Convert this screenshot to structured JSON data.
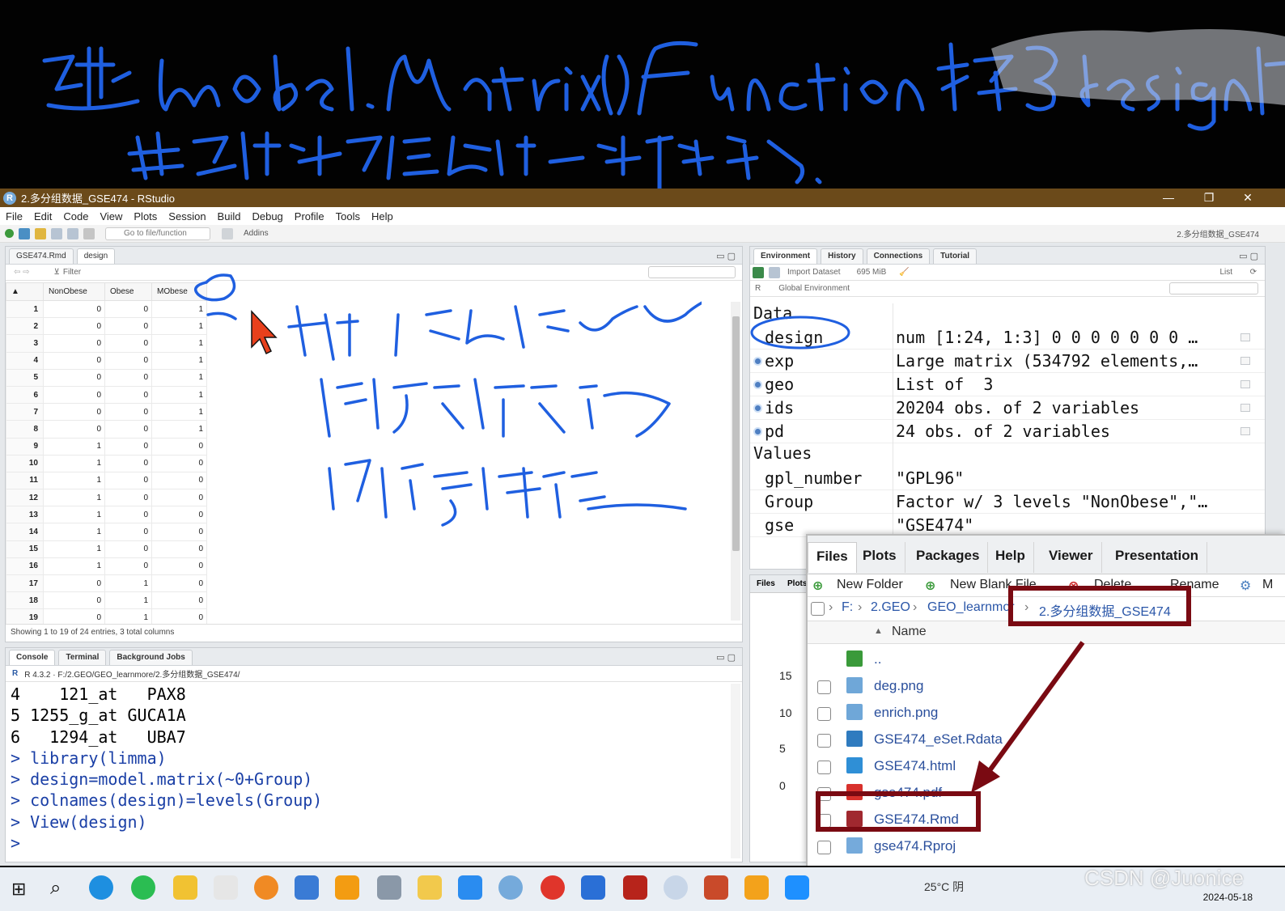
{
  "window": {
    "title": "2.多分组数据_GSE474 - RStudio",
    "controls": [
      "—",
      "❐",
      "✕"
    ]
  },
  "menu": [
    "File",
    "Edit",
    "Code",
    "View",
    "Plots",
    "Session",
    "Build",
    "Debug",
    "Profile",
    "Tools",
    "Help"
  ],
  "toolbar": {
    "goto_placeholder": "Go to file/function",
    "addins": "Addins",
    "project": "2.多分组数据_GSE474"
  },
  "source": {
    "tabs": [
      "GSE474.Rmd",
      "design"
    ],
    "filter": "Filter",
    "columns": [
      "NonObese",
      "Obese",
      "MObese"
    ],
    "rows": [
      [
        "1",
        "0",
        "0",
        "1"
      ],
      [
        "2",
        "0",
        "0",
        "1"
      ],
      [
        "3",
        "0",
        "0",
        "1"
      ],
      [
        "4",
        "0",
        "0",
        "1"
      ],
      [
        "5",
        "0",
        "0",
        "1"
      ],
      [
        "6",
        "0",
        "0",
        "1"
      ],
      [
        "7",
        "0",
        "0",
        "1"
      ],
      [
        "8",
        "0",
        "0",
        "1"
      ],
      [
        "9",
        "1",
        "0",
        "0"
      ],
      [
        "10",
        "1",
        "0",
        "0"
      ],
      [
        "11",
        "1",
        "0",
        "0"
      ],
      [
        "12",
        "1",
        "0",
        "0"
      ],
      [
        "13",
        "1",
        "0",
        "0"
      ],
      [
        "14",
        "1",
        "0",
        "0"
      ],
      [
        "15",
        "1",
        "0",
        "0"
      ],
      [
        "16",
        "1",
        "0",
        "0"
      ],
      [
        "17",
        "0",
        "1",
        "0"
      ],
      [
        "18",
        "0",
        "1",
        "0"
      ],
      [
        "19",
        "0",
        "1",
        "0"
      ]
    ],
    "status": "Showing 1 to 19 of 24 entries, 3 total columns"
  },
  "console": {
    "tabs": [
      "Console",
      "Terminal",
      "Background Jobs"
    ],
    "path": "R 4.3.2 · F:/2.GEO/GEO_learnmore/2.多分组数据_GSE474/",
    "lines": [
      {
        "type": "out",
        "text": "4    121_at   PAX8"
      },
      {
        "type": "out",
        "text": "5 1255_g_at GUCA1A"
      },
      {
        "type": "out",
        "text": "6   1294_at   UBA7"
      },
      {
        "type": "cmd",
        "text": "> library(limma)"
      },
      {
        "type": "cmd",
        "text": "> design=model.matrix(~0+Group)"
      },
      {
        "type": "cmd",
        "text": "> colnames(design)=levels(Group)"
      },
      {
        "type": "cmd",
        "text": "> View(design)"
      },
      {
        "type": "cmd",
        "text": "> "
      }
    ]
  },
  "environment": {
    "tabs": [
      "Environment",
      "History",
      "Connections",
      "Tutorial"
    ],
    "import_dataset": "Import Dataset",
    "memory": "695 MiB",
    "view_mode": "List",
    "lang": "R",
    "scope": "Global Environment",
    "data_header": "Data",
    "values_header": "Values",
    "data": [
      {
        "name": "design",
        "value": "num [1:24, 1:3] 0 0 0 0 0 0 0 …",
        "dot": false
      },
      {
        "name": "exp",
        "value": "Large matrix (534792 elements,…",
        "dot": true
      },
      {
        "name": "geo",
        "value": "List of  3",
        "dot": true
      },
      {
        "name": "ids",
        "value": "20204 obs. of 2 variables",
        "dot": true
      },
      {
        "name": "pd",
        "value": "24 obs. of 2 variables",
        "dot": true
      }
    ],
    "values": [
      {
        "name": "gpl_number",
        "value": "\"GPL96\""
      },
      {
        "name": "Group",
        "value": "Factor w/ 3 levels \"NonObese\",\"…"
      },
      {
        "name": "gse",
        "value": "\"GSE474\""
      }
    ]
  },
  "files_bg": {
    "tabs": [
      "Files",
      "Plots"
    ],
    "yticks": [
      "15",
      "10",
      "5",
      "0"
    ]
  },
  "files_popup": {
    "tabs": [
      "Files",
      "Plots",
      "Packages",
      "Help",
      "Viewer",
      "Presentation"
    ],
    "new_folder": "New Folder",
    "new_blank": "New Blank File",
    "delete": "Delete",
    "rename": "Rename",
    "more": "M",
    "breadcrumb": [
      "F:",
      "2.GEO",
      "GEO_learnmore",
      "2.多分组数据_GSE474"
    ],
    "name_header": "Name",
    "files": [
      {
        "name": "..",
        "icon": "up-arrow-icon",
        "checkbox": false
      },
      {
        "name": "deg.png",
        "icon": "image-icon",
        "checkbox": true
      },
      {
        "name": "enrich.png",
        "icon": "image-icon",
        "checkbox": true
      },
      {
        "name": "GSE474_eSet.Rdata",
        "icon": "rdata-icon",
        "checkbox": true
      },
      {
        "name": "GSE474.html",
        "icon": "html-icon",
        "checkbox": true
      },
      {
        "name": "gse474.pdf",
        "icon": "pdf-icon",
        "checkbox": true
      },
      {
        "name": "GSE474.Rmd",
        "icon": "rmd-icon",
        "checkbox": true
      },
      {
        "name": "gse474.Rproj",
        "icon": "rproj-icon",
        "checkbox": true
      }
    ]
  },
  "taskbar": {
    "weather": "25°C 阴",
    "date": "2024-05-18"
  },
  "watermark": "CSDN @Juonice",
  "colors": {
    "titlebar": "#6b4a1a",
    "ink": "#1f5fe0",
    "highlight": "#7a0a12",
    "cursor": "#e8401c"
  }
}
